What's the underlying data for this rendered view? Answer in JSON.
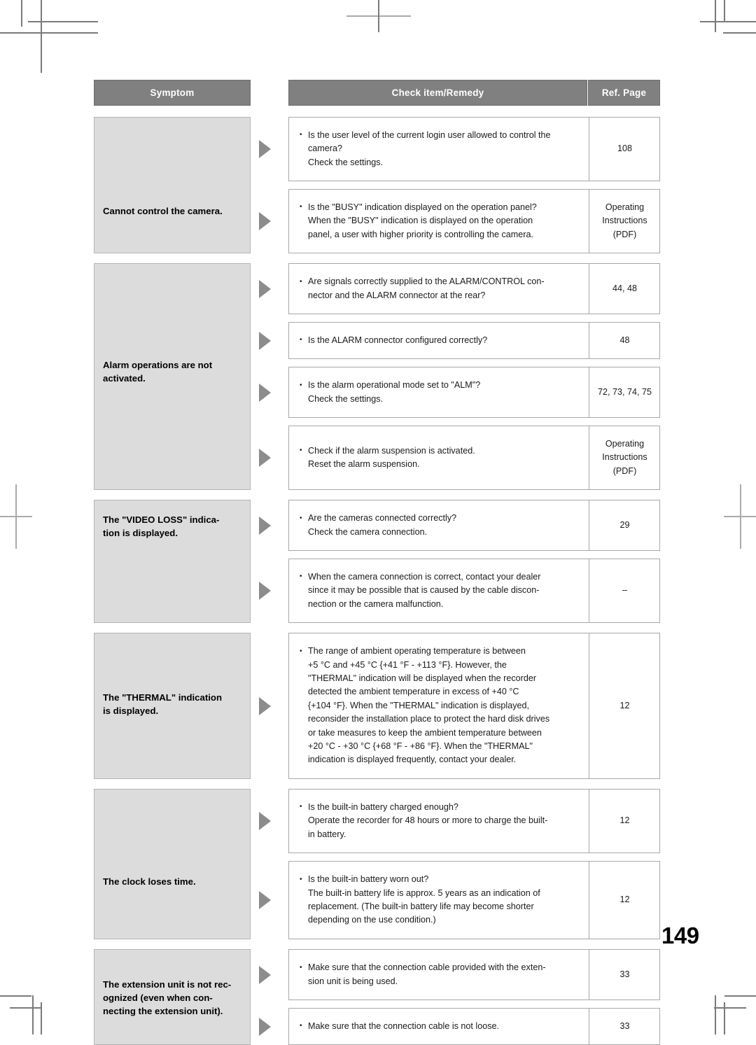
{
  "document": {
    "page_number": "149",
    "colors": {
      "header_fill": "#808080",
      "header_text": "#ffffff",
      "symptom_fill": "#dcdcdc",
      "arrow_fill": "#8c8c8c",
      "border": "#a8a8a8"
    }
  },
  "table": {
    "headers": {
      "symptom": "Symptom",
      "check_item": "Check item/Remedy",
      "ref_page": "Ref. Page"
    },
    "rows": [
      {
        "symptom": "Cannot control the camera.",
        "remedies": [
          {
            "lines": [
              "Is the user level of the current login user allowed to control the",
              "camera?",
              "Check the settings."
            ],
            "ref": [
              "108"
            ]
          },
          {
            "lines": [
              "Is the \"BUSY\" indication displayed on the operation panel?",
              "When the \"BUSY\" indication is displayed on the operation",
              "panel, a user with higher priority is controlling the camera."
            ],
            "ref": [
              "Operating",
              "Instructions",
              "(PDF)"
            ]
          }
        ]
      },
      {
        "symptom": "Alarm operations are not activated.",
        "remedies": [
          {
            "lines": [
              "Are signals correctly supplied to the ALARM/CONTROL con-",
              "nector and the ALARM connector at the rear?"
            ],
            "ref": [
              "44, 48"
            ]
          },
          {
            "lines": [
              "Is the ALARM connector configured correctly?"
            ],
            "ref": [
              "48"
            ]
          },
          {
            "lines": [
              "Is the alarm operational mode set to \"ALM\"?",
              "Check the settings."
            ],
            "ref": [
              "72, 73, 74, 75"
            ]
          },
          {
            "lines": [
              "Check if the alarm suspension is activated.",
              "Reset the alarm suspension."
            ],
            "ref": [
              "Operating",
              "Instructions",
              "(PDF)"
            ]
          }
        ]
      },
      {
        "symptom": "The \"VIDEO LOSS\" indication is displayed.",
        "remedies": [
          {
            "lines": [
              "Are the cameras connected correctly?",
              "Check the camera connection."
            ],
            "ref": [
              "29"
            ]
          },
          {
            "lines": [
              "When the camera connection is correct, contact your dealer",
              "since it may be possible that is caused by the cable discon-",
              "nection or the camera malfunction."
            ],
            "ref": [
              "–"
            ]
          }
        ]
      },
      {
        "symptom": "The \"THERMAL\" indication is displayed.",
        "remedies": [
          {
            "lines": [
              "The range of ambient operating temperature is between",
              "+5 °C and +45 °C {+41 °F - +113 °F}. However, the",
              "\"THERMAL\" indication will be displayed when the recorder",
              "detected the ambient temperature in excess of +40 °C",
              "{+104 °F}. When the \"THERMAL\" indication is displayed,",
              "reconsider the installation place to protect the hard disk drives",
              "or take measures to keep the ambient temperature between",
              "+20 °C - +30 °C {+68 °F - +86 °F}. When the \"THERMAL\"",
              "indication is displayed frequently, contact your dealer."
            ],
            "ref": [
              "12"
            ]
          }
        ]
      },
      {
        "symptom": "The clock loses time.",
        "remedies": [
          {
            "lines": [
              "Is the built-in battery charged enough?",
              "Operate the recorder for 48 hours or more to charge the built-",
              "in battery."
            ],
            "ref": [
              "12"
            ]
          },
          {
            "lines": [
              "Is the built-in battery worn out?",
              "The built-in battery life is approx. 5 years as an indication of",
              "replacement. (The built-in battery life may become shorter",
              "depending on the use condition.)"
            ],
            "ref": [
              "12"
            ]
          }
        ]
      },
      {
        "symptom": "The extension unit is not recognized (even when connecting the extension unit).",
        "symptom_lines": [
          "The extension unit is not rec-",
          "ognized (even when con-",
          "necting the extension unit)."
        ],
        "remedies": [
          {
            "lines": [
              "Make sure that the connection cable provided with the exten-",
              "sion unit is being used."
            ],
            "ref": [
              "33"
            ]
          },
          {
            "lines": [
              "Make sure that the connection cable is not loose."
            ],
            "ref": [
              "33"
            ]
          }
        ]
      }
    ]
  },
  "layout": {
    "symptom_lines_overrides": {
      "0": [
        "Cannot control the camera."
      ],
      "1": [
        "Alarm operations are not",
        "activated."
      ],
      "2": [
        "The \"VIDEO LOSS\" indica-",
        "tion is displayed."
      ],
      "3": [
        "The \"THERMAL\" indication",
        "is displayed."
      ],
      "4": [
        "The clock loses time."
      ],
      "5": [
        "The extension unit is not rec-",
        "ognized (even when con-",
        "necting the extension unit)."
      ]
    }
  }
}
